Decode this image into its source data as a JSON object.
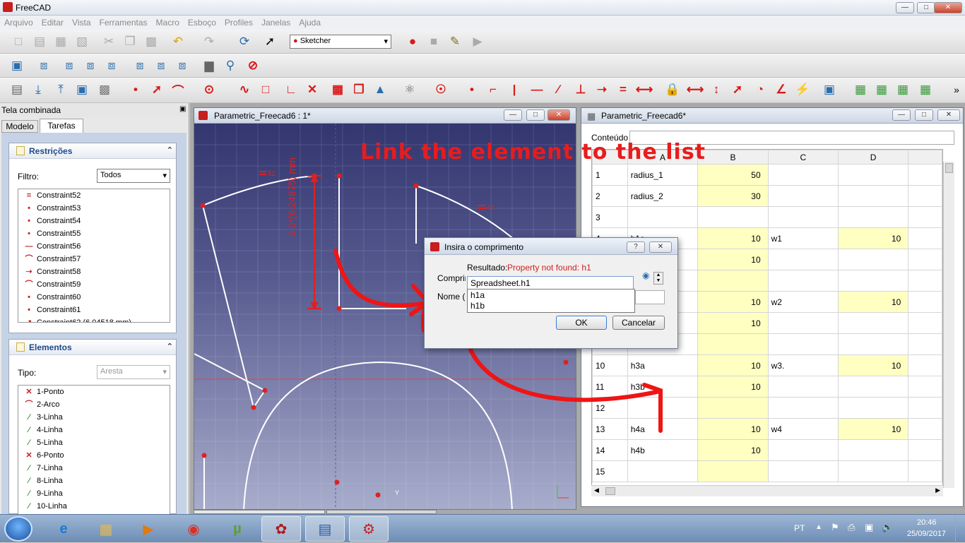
{
  "window": {
    "title": "FreeCAD"
  },
  "menu": [
    "Arquivo",
    "Editar",
    "Vista",
    "Ferramentas",
    "Macro",
    "Esboço",
    "Profiles",
    "Janelas",
    "Ajuda"
  ],
  "toolbar": {
    "workbench": "Sketcher"
  },
  "left_panel": {
    "title": "Tela combinada",
    "tabs": [
      "Modelo",
      "Tarefas"
    ],
    "restricoes": {
      "header": "Restrições",
      "filter_label": "Filtro:",
      "filter_value": "Todos",
      "items": [
        {
          "label": "Constraint52",
          "icon": "equal-icon"
        },
        {
          "label": "Constraint53",
          "icon": "point-on-object-icon"
        },
        {
          "label": "Constraint54",
          "icon": "point-on-object-icon"
        },
        {
          "label": "Constraint55",
          "icon": "point-on-object-icon"
        },
        {
          "label": "Constraint56",
          "icon": "horizontal-icon"
        },
        {
          "label": "Constraint57",
          "icon": "tangent-icon"
        },
        {
          "label": "Constraint58",
          "icon": "perpendicular-icon"
        },
        {
          "label": "Constraint59",
          "icon": "tangent-icon"
        },
        {
          "label": "Constraint60",
          "icon": "point-on-object-icon"
        },
        {
          "label": "Constraint61",
          "icon": "point-on-object-icon"
        },
        {
          "label": "Constraint62 (6.04518 mm)",
          "icon": "distance-icon"
        }
      ]
    },
    "elementos": {
      "header": "Elementos",
      "type_label": "Tipo:",
      "type_value": "Aresta",
      "items": [
        {
          "label": "1-Ponto",
          "icon": "point-cross-icon"
        },
        {
          "label": "2-Arco",
          "icon": "arc-icon"
        },
        {
          "label": "3-Linha",
          "icon": "line-icon"
        },
        {
          "label": "4-Linha",
          "icon": "line-icon"
        },
        {
          "label": "5-Linha",
          "icon": "line-icon"
        },
        {
          "label": "6-Ponto",
          "icon": "point-cross-icon"
        },
        {
          "label": "7-Linha",
          "icon": "line-icon"
        },
        {
          "label": "8-Linha",
          "icon": "line-icon"
        },
        {
          "label": "9-Linha",
          "icon": "line-icon"
        },
        {
          "label": "10-Linha",
          "icon": "line-icon"
        }
      ]
    }
  },
  "sketch_window": {
    "title": "Parametric_Freecad6 : 1*",
    "dim_vertical": "6.0*(6.24875) mm",
    "constraint_tag_52": "52",
    "constraint_tag_46": "46",
    "annotation": "Link the element  to the list",
    "bottom_tabs": [
      "Parametric_Freecad6 : 1*",
      "Parametric_Freecad6*"
    ]
  },
  "dialog": {
    "title": "Insira o comprimento",
    "result_label": "Resultado:",
    "result_value": "Property not found: h1",
    "length_label": "Comprimento:",
    "length_value": "Spreadsheet.h1",
    "name_label": "Nome (opcional):",
    "suggestions": [
      "h1a",
      "h1b"
    ],
    "ok": "OK",
    "cancel": "Cancelar"
  },
  "spreadsheet": {
    "title": "Parametric_Freecad6*",
    "content_label": "Conteúdo",
    "columns": [
      "A",
      "B",
      "C",
      "D"
    ],
    "rows": [
      {
        "n": "1",
        "a": "radius_1",
        "b": "50",
        "c": "",
        "d": ""
      },
      {
        "n": "2",
        "a": "radius_2",
        "b": "30",
        "c": "",
        "d": ""
      },
      {
        "n": "3",
        "a": "",
        "b": "",
        "c": "",
        "d": ""
      },
      {
        "n": "4",
        "a": "h1a",
        "b": "10",
        "c": "w1",
        "d": "10"
      },
      {
        "n": "5",
        "a": "h1b",
        "b": "10",
        "c": "",
        "d": ""
      },
      {
        "n": "6",
        "a": "",
        "b": "",
        "c": "",
        "d": ""
      },
      {
        "n": "7",
        "a": "h2a",
        "b": "10",
        "c": "w2",
        "d": "10"
      },
      {
        "n": "8",
        "a": "h2b",
        "b": "10",
        "c": "",
        "d": ""
      },
      {
        "n": "9",
        "a": "",
        "b": "",
        "c": "",
        "d": ""
      },
      {
        "n": "10",
        "a": "h3a",
        "b": "10",
        "c": "w3.",
        "d": "10"
      },
      {
        "n": "11",
        "a": "h3b",
        "b": "10",
        "c": "",
        "d": ""
      },
      {
        "n": "12",
        "a": "",
        "b": "",
        "c": "",
        "d": ""
      },
      {
        "n": "13",
        "a": "h4a",
        "b": "10",
        "c": "w4",
        "d": "10"
      },
      {
        "n": "14",
        "a": "h4b",
        "b": "10",
        "c": "",
        "d": ""
      },
      {
        "n": "15",
        "a": "",
        "b": "",
        "c": "",
        "d": ""
      }
    ]
  },
  "taskbar": {
    "lang": "PT",
    "time": "20:46",
    "date": "25/09/2017"
  },
  "colors": {
    "accent_red": "#e02020",
    "sketch_bg_top": "#3b3f7a",
    "sketch_bg_bottom": "#a3a7c8",
    "cell_yellow": "#ffffc2"
  }
}
